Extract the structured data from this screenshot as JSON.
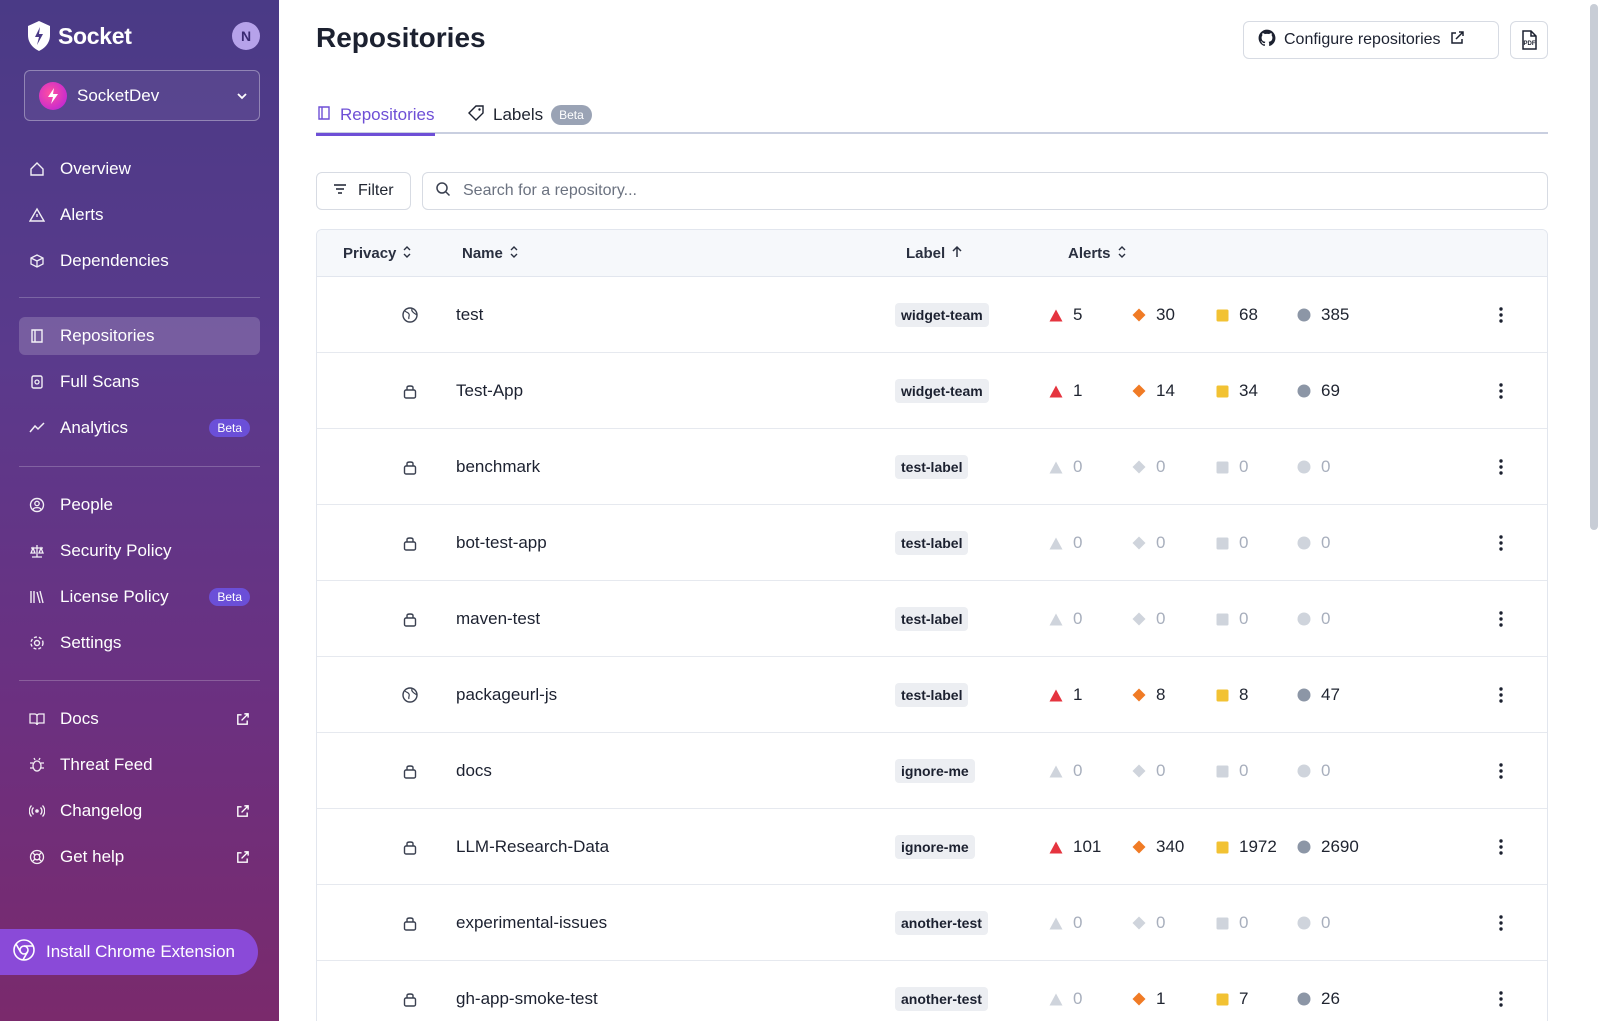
{
  "app": {
    "brand": "Socket",
    "user_initial": "N",
    "org": "SocketDev"
  },
  "sidebar": {
    "items": [
      {
        "label": "Overview",
        "icon": "home-icon"
      },
      {
        "label": "Alerts",
        "icon": "warning-icon"
      },
      {
        "label": "Dependencies",
        "icon": "package-icon"
      },
      {
        "label": "Repositories",
        "icon": "book-icon",
        "active": true
      },
      {
        "label": "Full Scans",
        "icon": "scan-icon"
      },
      {
        "label": "Analytics",
        "icon": "chart-line-icon",
        "badge": "Beta"
      },
      {
        "label": "People",
        "icon": "user-circle-icon"
      },
      {
        "label": "Security Policy",
        "icon": "scale-icon"
      },
      {
        "label": "License Policy",
        "icon": "books-icon",
        "badge": "Beta"
      },
      {
        "label": "Settings",
        "icon": "gear-icon"
      },
      {
        "label": "Docs",
        "icon": "open-book-icon",
        "external": true
      },
      {
        "label": "Threat Feed",
        "icon": "bug-icon"
      },
      {
        "label": "Changelog",
        "icon": "broadcast-icon",
        "external": true
      },
      {
        "label": "Get help",
        "icon": "lifebuoy-icon",
        "external": true
      }
    ],
    "chrome_extension": "Install Chrome Extension"
  },
  "header": {
    "title": "Repositories",
    "configure_label": "Configure repositories",
    "pdf_label": "PDF"
  },
  "tabs": [
    {
      "label": "Repositories",
      "active": true
    },
    {
      "label": "Labels",
      "badge": "Beta"
    }
  ],
  "toolbar": {
    "filter_label": "Filter",
    "search_placeholder": "Search for a repository..."
  },
  "table": {
    "columns": [
      "Privacy",
      "Name",
      "Label",
      "Alerts"
    ],
    "rows": [
      {
        "privacy": "public",
        "name": "test",
        "label": "widget-team",
        "alerts": [
          5,
          30,
          68,
          385
        ]
      },
      {
        "privacy": "private",
        "name": "Test-App",
        "label": "widget-team",
        "alerts": [
          1,
          14,
          34,
          69
        ]
      },
      {
        "privacy": "private",
        "name": "benchmark",
        "label": "test-label",
        "alerts": [
          0,
          0,
          0,
          0
        ]
      },
      {
        "privacy": "private",
        "name": "bot-test-app",
        "label": "test-label",
        "alerts": [
          0,
          0,
          0,
          0
        ]
      },
      {
        "privacy": "private",
        "name": "maven-test",
        "label": "test-label",
        "alerts": [
          0,
          0,
          0,
          0
        ]
      },
      {
        "privacy": "public",
        "name": "packageurl-js",
        "label": "test-label",
        "alerts": [
          1,
          8,
          8,
          47
        ]
      },
      {
        "privacy": "private",
        "name": "docs",
        "label": "ignore-me",
        "alerts": [
          0,
          0,
          0,
          0
        ]
      },
      {
        "privacy": "private",
        "name": "LLM-Research-Data",
        "label": "ignore-me",
        "alerts": [
          101,
          340,
          1972,
          2690
        ]
      },
      {
        "privacy": "private",
        "name": "experimental-issues",
        "label": "another-test",
        "alerts": [
          0,
          0,
          0,
          0
        ]
      },
      {
        "privacy": "private",
        "name": "gh-app-smoke-test",
        "label": "another-test",
        "alerts": [
          0,
          1,
          7,
          26
        ]
      }
    ]
  },
  "colors": {
    "critical": "#e5343f",
    "high": "#f07b25",
    "middle": "#f2c233",
    "low": "#8c96a6",
    "accent": "#6e4fd6"
  }
}
